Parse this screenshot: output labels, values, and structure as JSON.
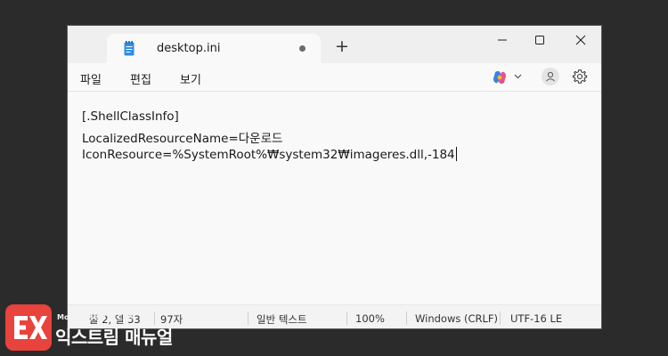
{
  "tab": {
    "title": "desktop.ini"
  },
  "menu": {
    "items": [
      "파일",
      "편집",
      "보기"
    ]
  },
  "editor": {
    "lines": [
      "[.ShellClassInfo]",
      "LocalizedResourceName=다운로드",
      "IconResource=%SystemRoot%₩system32₩imageres.dll,-184"
    ]
  },
  "status": {
    "position": "줄 2, 열 53",
    "chars": "97자",
    "format": "일반 텍스트",
    "zoom": "100%",
    "line_ending": "Windows (CRLF)",
    "encoding": "UTF-16 LE"
  },
  "watermark": {
    "tagline": "More Better IT Life",
    "brand": "익스트림 매뉴얼"
  },
  "colors": {
    "accent": "#e8433c",
    "window_bg": "#f9f9f9",
    "desktop_bg": "#2b2b2b"
  },
  "icons": [
    "notepad-icon",
    "new-tab-icon",
    "minimize-icon",
    "maximize-icon",
    "close-icon",
    "copilot-icon",
    "chevron-down-icon",
    "account-icon",
    "settings-gear-icon"
  ]
}
